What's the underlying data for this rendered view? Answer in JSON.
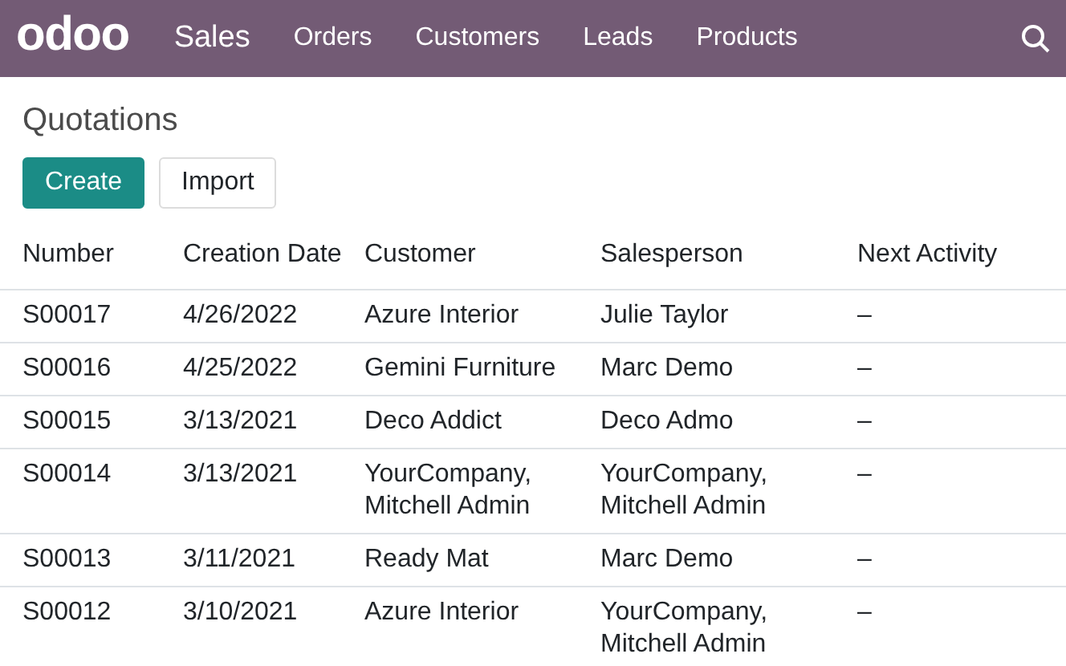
{
  "navbar": {
    "logo": "odoo",
    "app": "Sales",
    "menu": [
      "Orders",
      "Customers",
      "Leads",
      "Products"
    ]
  },
  "page_title": "Quotations",
  "buttons": [
    {
      "label": "Create",
      "kind": "primary"
    },
    {
      "label": "Import",
      "kind": "secondary"
    }
  ],
  "table": {
    "columns": [
      "Number",
      "Creation Date",
      "Customer",
      "Salesperson",
      "Next Activity"
    ],
    "rows": [
      [
        "S00017",
        "4/26/2022",
        "Azure Interior",
        "Julie Taylor",
        "–"
      ],
      [
        "S00016",
        "4/25/2022",
        "Gemini Furniture",
        "Marc Demo",
        "–"
      ],
      [
        "S00015",
        "3/13/2021",
        "Deco Addict",
        "Deco Admo",
        "–"
      ],
      [
        "S00014",
        "3/13/2021",
        "YourCompany, Mitchell Admin",
        "YourCompany, Mitchell Admin",
        "–"
      ],
      [
        "S00013",
        "3/11/2021",
        "Ready Mat",
        "Marc Demo",
        "–"
      ],
      [
        "S00012",
        "3/10/2021",
        "Azure Interior",
        "YourCompany, Mitchell Admin",
        "–"
      ]
    ]
  }
}
